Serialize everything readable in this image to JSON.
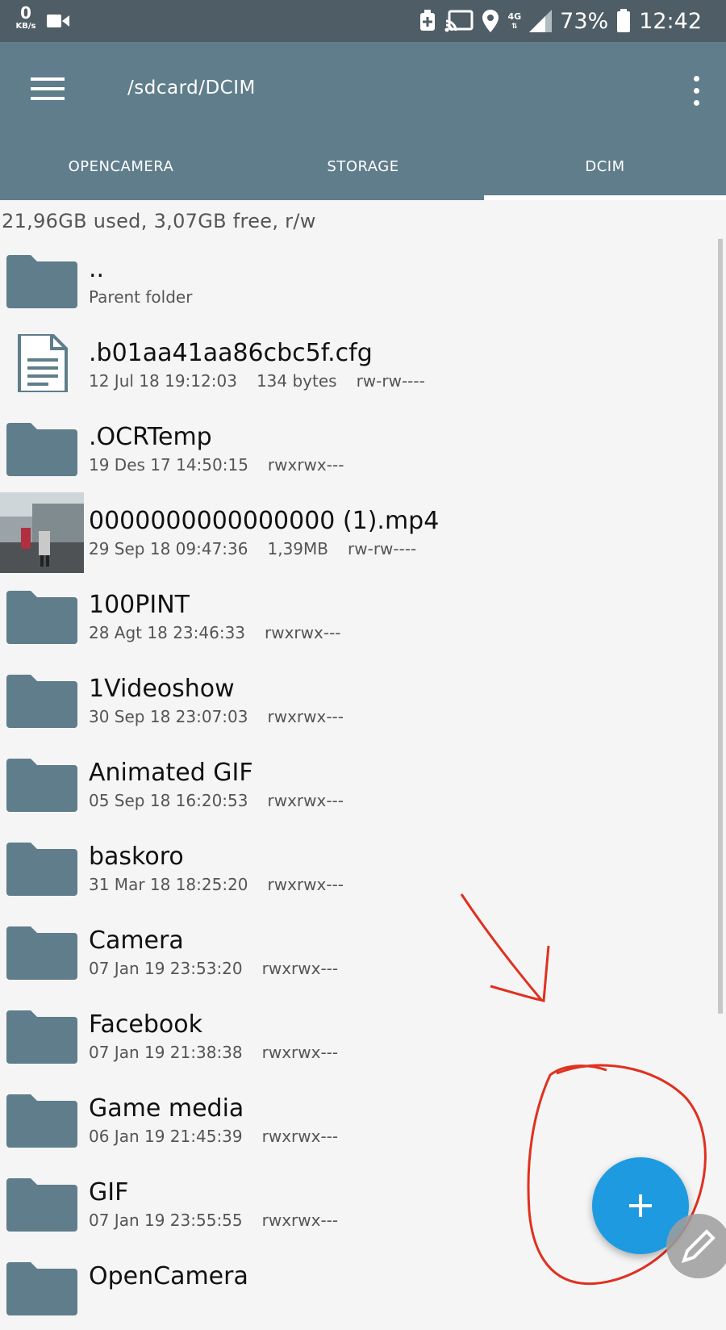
{
  "status_bar": {
    "net_speed_value": "0",
    "net_speed_unit": "KB/s",
    "network_type": "4G",
    "battery_percent": "73%",
    "time": "12:42"
  },
  "toolbar": {
    "path": "/sdcard/DCIM"
  },
  "tabs": [
    {
      "label": "OPENCAMERA",
      "active": false
    },
    {
      "label": "STORAGE",
      "active": false
    },
    {
      "label": "DCIM",
      "active": true
    }
  ],
  "storage_info": "21,96GB used, 3,07GB free, r/w",
  "files": [
    {
      "name": "..",
      "date": "Parent folder",
      "size": "",
      "perms": "",
      "type": "folder"
    },
    {
      "name": ".b01aa41aa86cbc5f.cfg",
      "date": "12 Jul 18 19:12:03",
      "size": "134 bytes",
      "perms": "rw-rw----",
      "type": "document"
    },
    {
      "name": ".OCRTemp",
      "date": "19 Des 17 14:50:15",
      "size": "",
      "perms": "rwxrwx---",
      "type": "folder"
    },
    {
      "name": "0000000000000000 (1).mp4",
      "date": "29 Sep 18 09:47:36",
      "size": "1,39MB",
      "perms": "rw-rw----",
      "type": "video"
    },
    {
      "name": "100PINT",
      "date": "28 Agt 18 23:46:33",
      "size": "",
      "perms": "rwxrwx---",
      "type": "folder"
    },
    {
      "name": "1Videoshow",
      "date": "30 Sep 18 23:07:03",
      "size": "",
      "perms": "rwxrwx---",
      "type": "folder"
    },
    {
      "name": "Animated GIF",
      "date": "05 Sep 18 16:20:53",
      "size": "",
      "perms": "rwxrwx---",
      "type": "folder"
    },
    {
      "name": "baskoro",
      "date": "31 Mar 18 18:25:20",
      "size": "",
      "perms": "rwxrwx---",
      "type": "folder"
    },
    {
      "name": "Camera",
      "date": "07 Jan 19 23:53:20",
      "size": "",
      "perms": "rwxrwx---",
      "type": "folder"
    },
    {
      "name": "Facebook",
      "date": "07 Jan 19 21:38:38",
      "size": "",
      "perms": "rwxrwx---",
      "type": "folder"
    },
    {
      "name": "Game media",
      "date": "06 Jan 19 21:45:39",
      "size": "",
      "perms": "rwxrwx---",
      "type": "folder"
    },
    {
      "name": "GIF",
      "date": "07 Jan 19 23:55:55",
      "size": "",
      "perms": "rwxrwx---",
      "type": "folder"
    },
    {
      "name": "OpenCamera",
      "date": "",
      "size": "",
      "perms": "",
      "type": "folder"
    }
  ],
  "colors": {
    "toolbar": "#607d8b",
    "status_bar": "#4f5d66",
    "folder_icon": "#607d8b",
    "fab": "#1e9be0",
    "annotation": "#e03020"
  },
  "icons": {
    "fab": "plus-icon",
    "edit": "pencil-icon",
    "folder": "folder-icon",
    "document": "document-icon"
  }
}
